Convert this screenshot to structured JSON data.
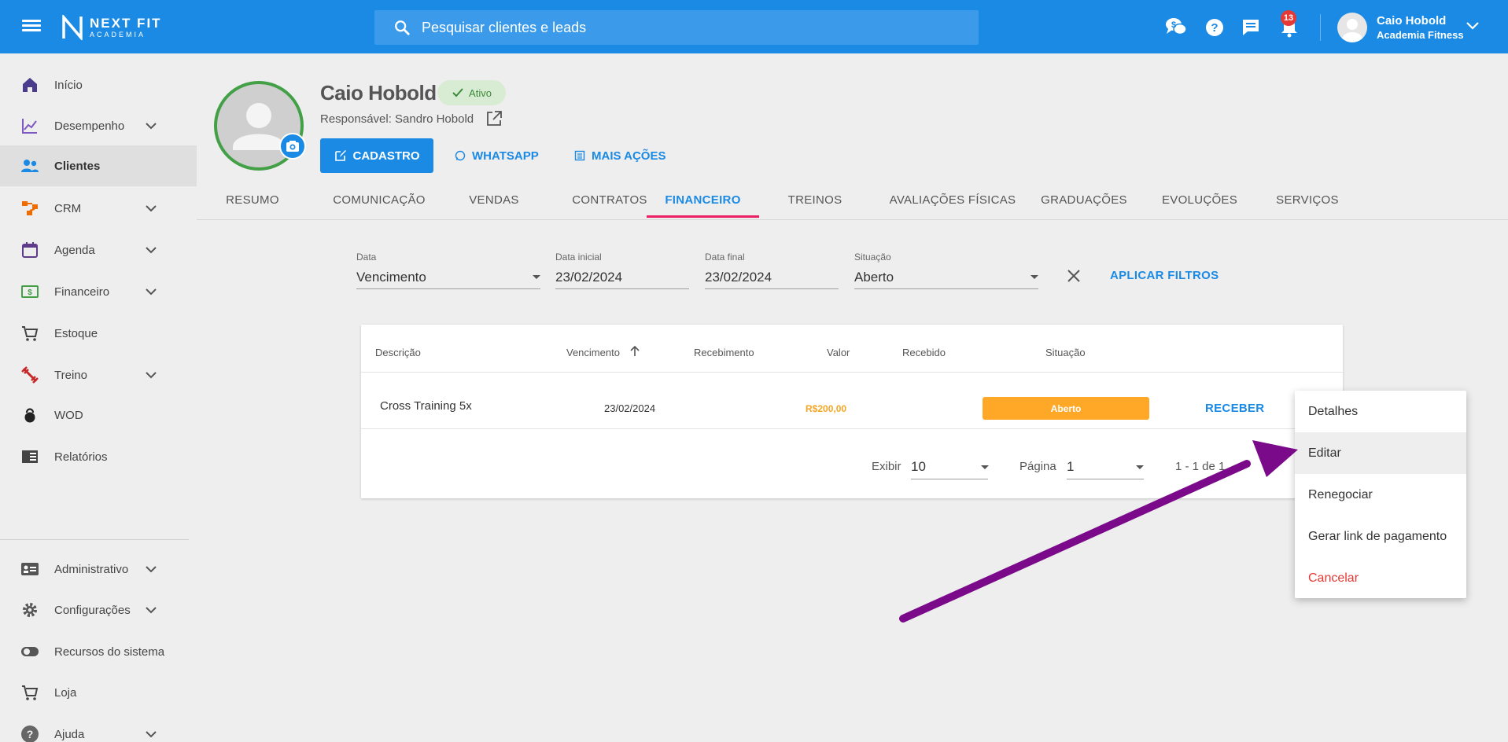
{
  "topbar": {
    "brand_line1": "NEXT FIT",
    "brand_line2": "ACADEMIA",
    "search_placeholder": "Pesquisar clientes e leads",
    "notification_count": "13",
    "user_name": "Caio Hobold",
    "user_org": "Academia Fitness",
    "accent_color": "#1a8ae5",
    "icons": [
      "menu-icon",
      "search-icon",
      "currency-chat-icon",
      "help-icon",
      "message-icon",
      "bell-icon",
      "chevron-down-icon"
    ]
  },
  "sidebar": {
    "items": [
      {
        "label": "Início",
        "icon": "home-icon",
        "expandable": false
      },
      {
        "label": "Desempenho",
        "icon": "chart-line-icon",
        "expandable": true
      },
      {
        "label": "Clientes",
        "icon": "people-icon",
        "expandable": false,
        "active": true
      },
      {
        "label": "CRM",
        "icon": "crm-icon",
        "expandable": true
      },
      {
        "label": "Agenda",
        "icon": "calendar-icon",
        "expandable": true
      },
      {
        "label": "Financeiro",
        "icon": "money-icon",
        "expandable": true
      },
      {
        "label": "Estoque",
        "icon": "cart-icon",
        "expandable": false
      },
      {
        "label": "Treino",
        "icon": "dumbbell-icon",
        "expandable": true
      },
      {
        "label": "WOD",
        "icon": "kettlebell-icon",
        "expandable": false
      },
      {
        "label": "Relatórios",
        "icon": "report-icon",
        "expandable": false
      },
      {
        "label": "Administrativo",
        "icon": "id-card-icon",
        "expandable": true
      },
      {
        "label": "Configurações",
        "icon": "gear-icon",
        "expandable": true
      },
      {
        "label": "Recursos do sistema",
        "icon": "toggle-icon",
        "expandable": false
      },
      {
        "label": "Loja",
        "icon": "cart-icon",
        "expandable": false
      },
      {
        "label": "Ajuda",
        "icon": "help-icon",
        "expandable": true
      }
    ]
  },
  "client": {
    "name": "Caio Hobold",
    "status": "Ativo",
    "responsible": "Responsável: Sandro Hobold",
    "btn_cadastro": "CADASTRO",
    "btn_whatsapp": "WHATSAPP",
    "btn_more": "MAIS AÇÕES"
  },
  "tabs": [
    "RESUMO",
    "COMUNICAÇÃO",
    "VENDAS",
    "CONTRATOS",
    "FINANCEIRO",
    "TREINOS",
    "AVALIAÇÕES FÍSICAS",
    "GRADUAÇÕES",
    "EVOLUÇÕES",
    "SERVIÇOS"
  ],
  "active_tab": "FINANCEIRO",
  "filters": {
    "data_label": "Data",
    "data_value": "Vencimento",
    "inicial_label": "Data inicial",
    "inicial_value": "23/02/2024",
    "final_label": "Data final",
    "final_value": "23/02/2024",
    "situacao_label": "Situação",
    "situacao_value": "Aberto",
    "apply_label": "APLICAR FILTROS"
  },
  "table": {
    "headers": [
      "Descrição",
      "Vencimento",
      "Recebimento",
      "Valor",
      "Recebido",
      "Situação"
    ],
    "rows": [
      {
        "descricao": "Cross Training 5x",
        "vencimento": "23/02/2024",
        "recebimento": "",
        "valor": "R$200,00",
        "recebido": "",
        "situacao": "Aberto",
        "action": "RECEBER"
      }
    ],
    "status_color": "#ffa726",
    "pagination": {
      "show_label": "Exibir",
      "show_value": "10",
      "page_label": "Página",
      "page_value": "1",
      "range": "1 - 1 de 1"
    }
  },
  "context_menu": {
    "items": [
      "Detalhes",
      "Editar",
      "Renegociar",
      "Gerar link de pagamento",
      "Cancelar"
    ],
    "highlighted": "Editar",
    "danger_color": "#e53935"
  },
  "annotation_arrow_color": "#7b0a8a"
}
